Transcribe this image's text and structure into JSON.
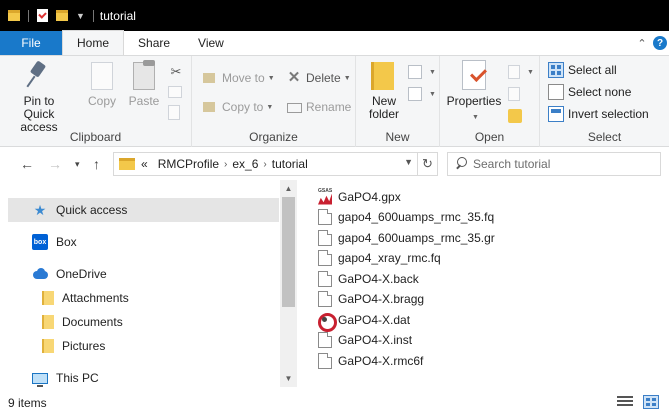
{
  "window": {
    "title": "tutorial",
    "quick_access_toolbar": [
      "folder-icon",
      "properties-icon",
      "new-folder-icon",
      "customize-dropdown"
    ]
  },
  "tabs": [
    {
      "label": "File"
    },
    {
      "label": "Home"
    },
    {
      "label": "Share"
    },
    {
      "label": "View"
    }
  ],
  "ribbon": {
    "clipboard": {
      "label": "Clipboard",
      "pin": "Pin to Quick access",
      "pin_line1": "Pin to Quick",
      "pin_line2": "access",
      "copy": "Copy",
      "paste": "Paste"
    },
    "organize": {
      "label": "Organize",
      "move_to": "Move to",
      "copy_to": "Copy to",
      "delete": "Delete",
      "rename": "Rename"
    },
    "new": {
      "label": "New",
      "new_folder_line1": "New",
      "new_folder_line2": "folder"
    },
    "open": {
      "label": "Open",
      "properties": "Properties"
    },
    "select": {
      "label": "Select",
      "select_all": "Select all",
      "select_none": "Select none",
      "invert_selection": "Invert selection"
    }
  },
  "address": {
    "overflow": "«",
    "crumbs": [
      "RMCProfile",
      "ex_6",
      "tutorial"
    ]
  },
  "search": {
    "placeholder": "Search tutorial"
  },
  "nav": {
    "items": [
      {
        "label": "Quick access",
        "icon": "star-icon"
      },
      {
        "label": "Box",
        "icon": "box-icon"
      },
      {
        "label": "OneDrive",
        "icon": "cloud-icon"
      },
      {
        "label": "Attachments",
        "icon": "folder-icon"
      },
      {
        "label": "Documents",
        "icon": "folder-icon"
      },
      {
        "label": "Pictures",
        "icon": "folder-icon"
      },
      {
        "label": "This PC",
        "icon": "computer-icon"
      }
    ],
    "box_icon_text": "box"
  },
  "files": [
    {
      "name": "GaPO4.gpx",
      "icon": "gsas-icon"
    },
    {
      "name": "gapo4_600uamps_rmc_35.fq",
      "icon": "document-icon"
    },
    {
      "name": "gapo4_600uamps_rmc_35.gr",
      "icon": "document-icon"
    },
    {
      "name": "gapo4_xray_rmc.fq",
      "icon": "document-icon"
    },
    {
      "name": "GaPO4-X.back",
      "icon": "document-icon"
    },
    {
      "name": "GaPO4-X.bragg",
      "icon": "document-icon"
    },
    {
      "name": "GaPO4-X.dat",
      "icon": "dat-file-icon"
    },
    {
      "name": "GaPO4-X.inst",
      "icon": "document-icon"
    },
    {
      "name": "GaPO4-X.rmc6f",
      "icon": "document-icon"
    }
  ],
  "status": {
    "item_count": "9 items"
  },
  "colors": {
    "accent": "#1979ca",
    "titlebar": "#000000",
    "folder": "#f3c84a",
    "selection": "#e5e5e5"
  }
}
